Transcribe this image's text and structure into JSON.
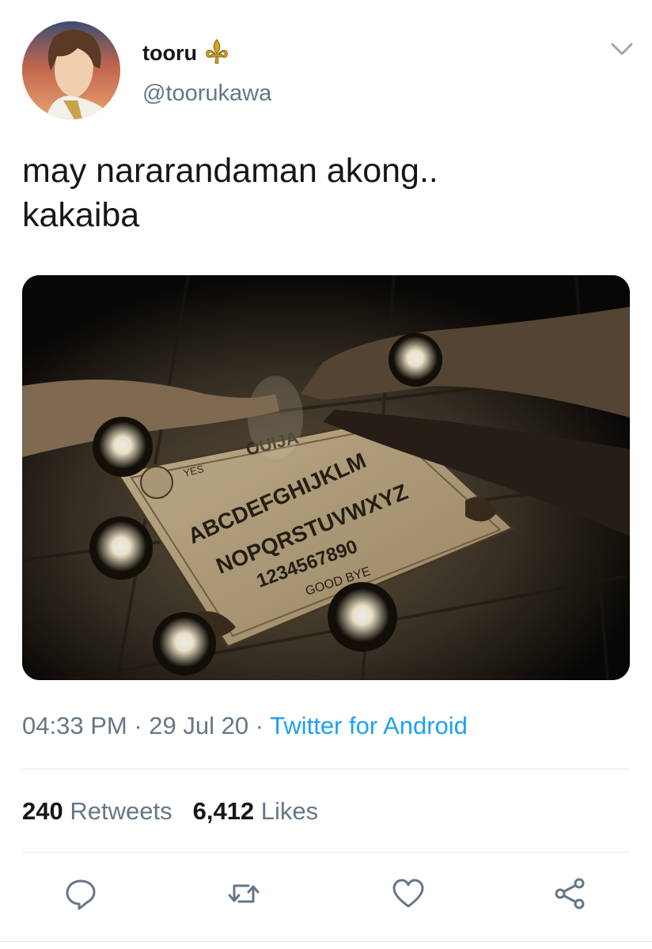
{
  "user": {
    "name": "tooru",
    "badge_icon": "fleur-de-lis-icon",
    "handle": "@toorukawa"
  },
  "tweet": {
    "lines": [
      "may nararandaman akong..",
      "kakaiba"
    ]
  },
  "media": {
    "board": {
      "yes": "YES",
      "brand": "OUIJA",
      "row1": "ABCDEFGHIJKLM",
      "row2": "NOPQRSTUVWXYZ",
      "numbers": "1234567890",
      "goodbye": "GOOD BYE"
    }
  },
  "meta": {
    "time": "04:33 PM",
    "sep1": " · ",
    "date": "29 Jul 20",
    "sep2": " · ",
    "source": "Twitter for Android"
  },
  "stats": {
    "retweets_count": "240",
    "retweets_label": "Retweets",
    "likes_count": "6,412",
    "likes_label": "Likes"
  },
  "actions": [
    "reply-icon",
    "retweet-icon",
    "like-icon",
    "share-icon"
  ],
  "colors": {
    "link": "#1da1f2",
    "secondary_text": "#657786",
    "primary_text": "#14171a",
    "badge": "#d9a21b"
  }
}
